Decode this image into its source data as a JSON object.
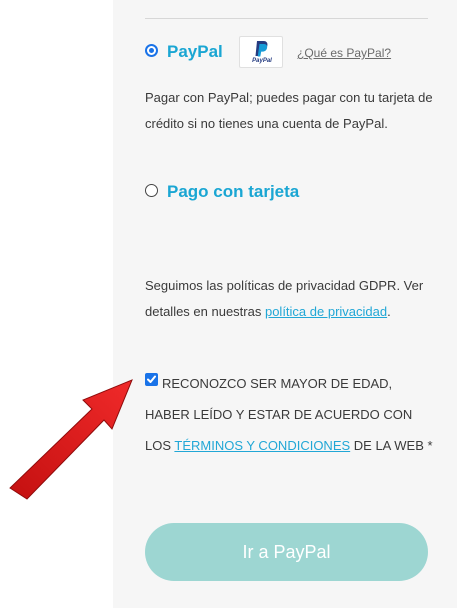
{
  "payment": {
    "paypal": {
      "label": "PayPal",
      "logo_text": "PayPal",
      "info_link": "¿Qué es PayPal?",
      "description": "Pagar con PayPal; puedes pagar con tu tarjeta de crédito si no tienes una cuenta de PayPal.",
      "selected": true
    },
    "card": {
      "label": "Pago con tarjeta",
      "selected": false
    }
  },
  "privacy": {
    "text_before": "Seguimos las políticas de privacidad GDPR. Ver detalles en nuestras ",
    "link": "política de privacidad",
    "text_after": "."
  },
  "terms": {
    "checked": true,
    "text_before": "RECONOZCO SER MAYOR DE EDAD, HABER LEÍDO Y ESTAR DE ACUERDO CON LOS ",
    "link": "TÉRMINOS Y CONDICIONES",
    "text_after": " DE LA WEB *"
  },
  "submit": {
    "label": "Ir a PayPal"
  },
  "colors": {
    "accent": "#1aa6d3",
    "link": "#21a7d6",
    "radio": "#1a73e8",
    "button": "#9dd6d2",
    "arrow": "#e21b1b"
  },
  "icons": [
    "paypal-logo-icon",
    "red-arrow-icon",
    "checkmark-icon"
  ]
}
